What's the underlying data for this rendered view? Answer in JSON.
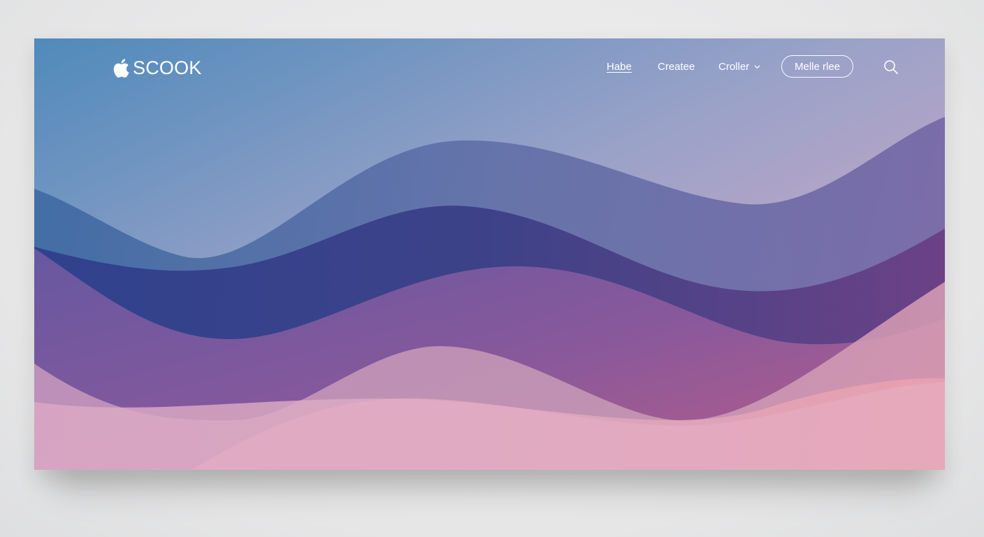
{
  "brand": {
    "logo_icon": "apple-icon",
    "name": "SCOOK"
  },
  "nav": {
    "items": [
      {
        "label": "Habe",
        "active": true
      },
      {
        "label": "Createe",
        "active": false
      },
      {
        "label": "Croller",
        "active": false,
        "has_dropdown": true,
        "dropdown_icon": "chevron-down-icon"
      }
    ],
    "cta_label": "Melle rlee",
    "search_icon": "search-icon"
  },
  "theme": {
    "sky_top": "#5a8fbe",
    "sky_bottom": "#d3a4c9",
    "wave_blue": "#3a4690",
    "wave_purple": "#8a5aa0",
    "wave_pink": "#e7a7b6",
    "text": "#ffffff"
  }
}
